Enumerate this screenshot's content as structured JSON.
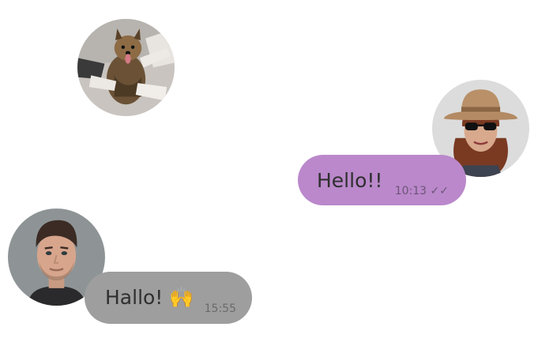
{
  "colors": {
    "outgoing_bubble": "#ba88cb",
    "incoming_bubble": "#9e9e9e",
    "outgoing_meta_text": "#6e5478",
    "incoming_meta_text": "#6a6a6a",
    "message_text": "#2f2f2f"
  },
  "avatars": {
    "dog": {
      "icon": "dog-photo-avatar"
    },
    "woman": {
      "icon": "woman-with-hat-photo-avatar"
    },
    "man": {
      "icon": "man-portrait-photo-avatar"
    }
  },
  "messages": [
    {
      "direction": "outgoing",
      "text": "Hello!!",
      "time": "10:13",
      "status_icon": "double-check-icon",
      "status": "✓✓"
    },
    {
      "direction": "incoming",
      "text": "Hallo! 🙌",
      "time": "15:55"
    }
  ]
}
